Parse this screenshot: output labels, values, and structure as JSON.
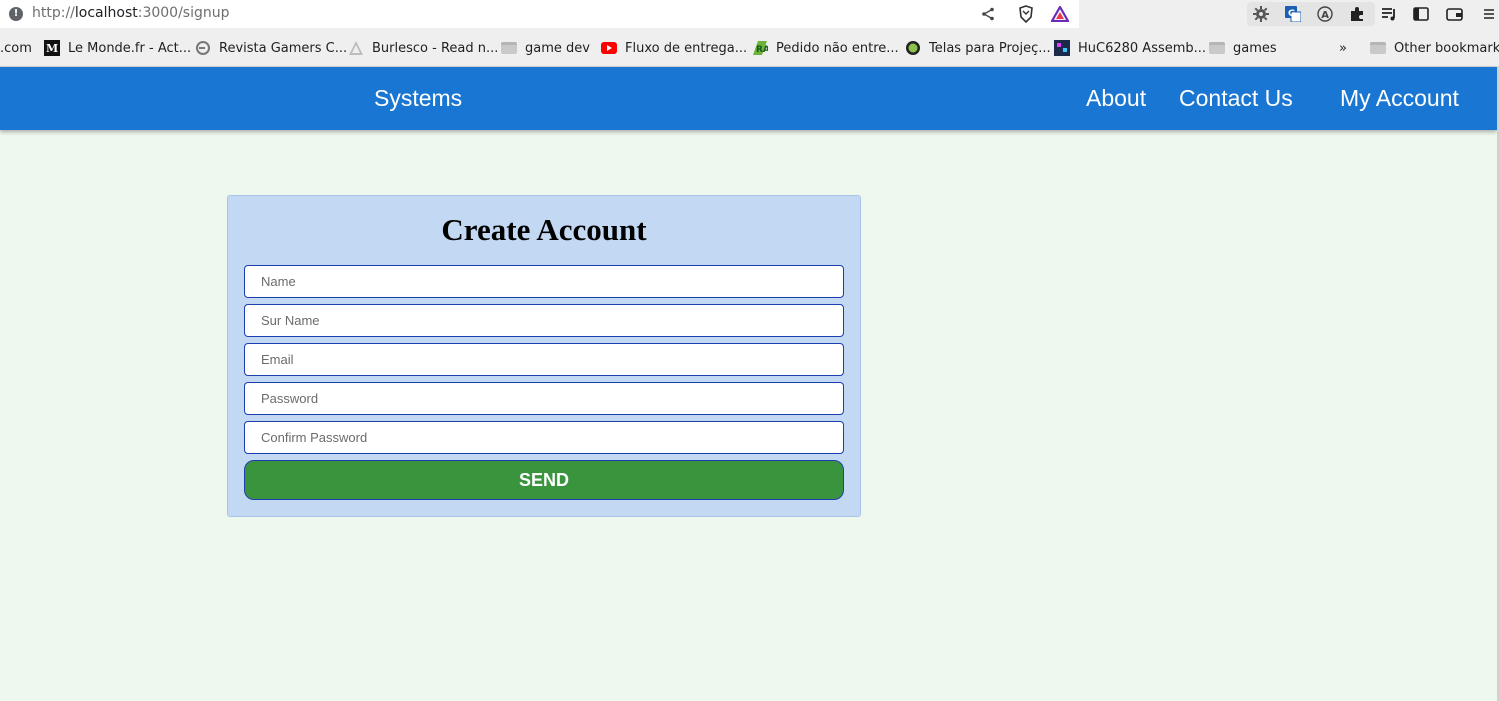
{
  "browser": {
    "url_scheme": "http://",
    "url_host": "localhost",
    "url_path": ":3000/signup",
    "icons": [
      "info-icon",
      "share-icon",
      "brave-shield-icon",
      "brave-rewards-icon",
      "extension-gear-icon",
      "extension-translate-icon",
      "extension-a-icon",
      "puzzle-icon",
      "playlist-icon",
      "sidebar-icon",
      "wallet-icon",
      "menu-icon"
    ]
  },
  "bookmarks": {
    "items": [
      {
        "label": ".com"
      },
      {
        "label": "Le Monde.fr - Act..."
      },
      {
        "label": "Revista Gamers C..."
      },
      {
        "label": "Burlesco - Read n..."
      },
      {
        "label": "game dev"
      },
      {
        "label": "Fluxo de entrega..."
      },
      {
        "label": "Pedido não entre..."
      },
      {
        "label": "Telas para Projeç..."
      },
      {
        "label": "HuC6280 Assemb..."
      },
      {
        "label": "games"
      }
    ],
    "overflow": "»",
    "other": "Other bookmarks"
  },
  "navbar": {
    "brand": "Systems",
    "links": [
      "About",
      "Contact Us",
      "My Account"
    ],
    "color": "#1976d2"
  },
  "form": {
    "title": "Create Account",
    "fields": [
      {
        "placeholder": "Name",
        "value": ""
      },
      {
        "placeholder": "Sur Name",
        "value": ""
      },
      {
        "placeholder": "Email",
        "value": ""
      },
      {
        "placeholder": "Password",
        "value": ""
      },
      {
        "placeholder": "Confirm Password",
        "value": ""
      }
    ],
    "submit_label": "SEND",
    "submit_color": "#3a943e"
  }
}
